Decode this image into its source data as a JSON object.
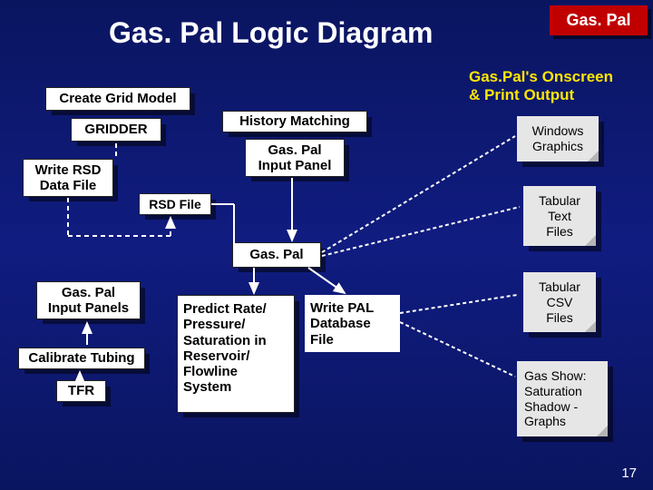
{
  "title": "Gas. Pal Logic Diagram",
  "badge": "Gas. Pal",
  "output_heading": "Gas.Pal's Onscreen\n& Print Output",
  "boxes": {
    "create_grid": "Create Grid Model",
    "gridder": "GRIDDER",
    "write_rsd": "Write RSD\nData File",
    "history_matching": "History Matching",
    "input_panel": "Gas. Pal\nInput Panel",
    "rsd_file": "RSD File",
    "gaspal": "Gas. Pal",
    "input_panels": "Gas. Pal\nInput Panels",
    "calibrate": "Calibrate Tubing",
    "tfr": "TFR",
    "predict": "Predict Rate/\nPressure/\nSaturation in\nReservoir/\nFlowline\nSystem",
    "write_pal": "Write PAL\nDatabase\nFile"
  },
  "notes": {
    "win_graphics": "Windows\nGraphics",
    "tab_text": "Tabular\nText\nFiles",
    "tab_csv": "Tabular\nCSV\nFiles",
    "gas_show": "Gas Show:\nSaturation\nShadow -\nGraphs"
  },
  "slide_number": "17"
}
